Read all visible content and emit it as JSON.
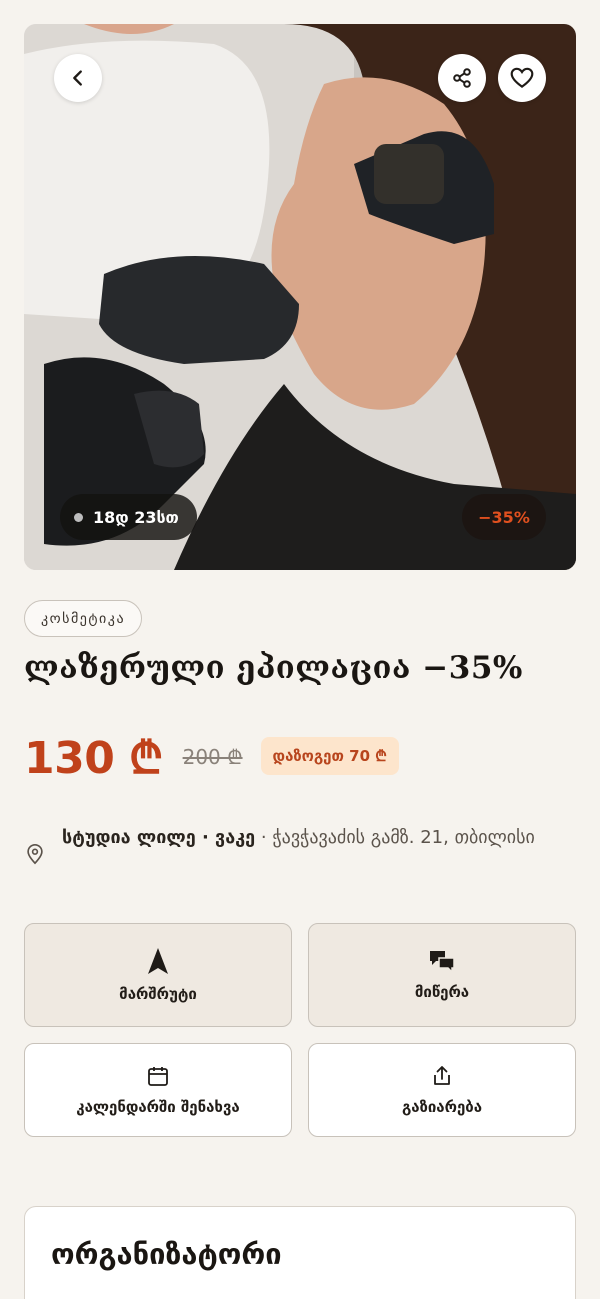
{
  "hero": {
    "timer_text": "18დ 23სთ",
    "discount_badge": "−35%",
    "icons": {
      "back": "chevron-left-icon",
      "share": "share-icon",
      "favorite": "heart-icon"
    }
  },
  "category_tag": "კოსმეტიკა",
  "title": "ლაზერული ეპილაცია −35%",
  "price": {
    "current": "130 ₾",
    "old": "200 ₾",
    "savings": "დაზოგეთ 70 ₾"
  },
  "location": {
    "venue": "სტუდია ლილე · ვაკე",
    "address": " · ჭავჭავაძის გამზ. 21, თბილისი"
  },
  "actions": {
    "route": "მარშრუტი",
    "message": "მიწერა",
    "calendar": "კალენდარში შენახვა",
    "share": "გაზიარება"
  },
  "organizer": {
    "title": "ორგანიზატორი"
  },
  "colors": {
    "accent": "#c0421b",
    "background": "#f6f3ee",
    "savings_bg": "#fde5cc"
  }
}
